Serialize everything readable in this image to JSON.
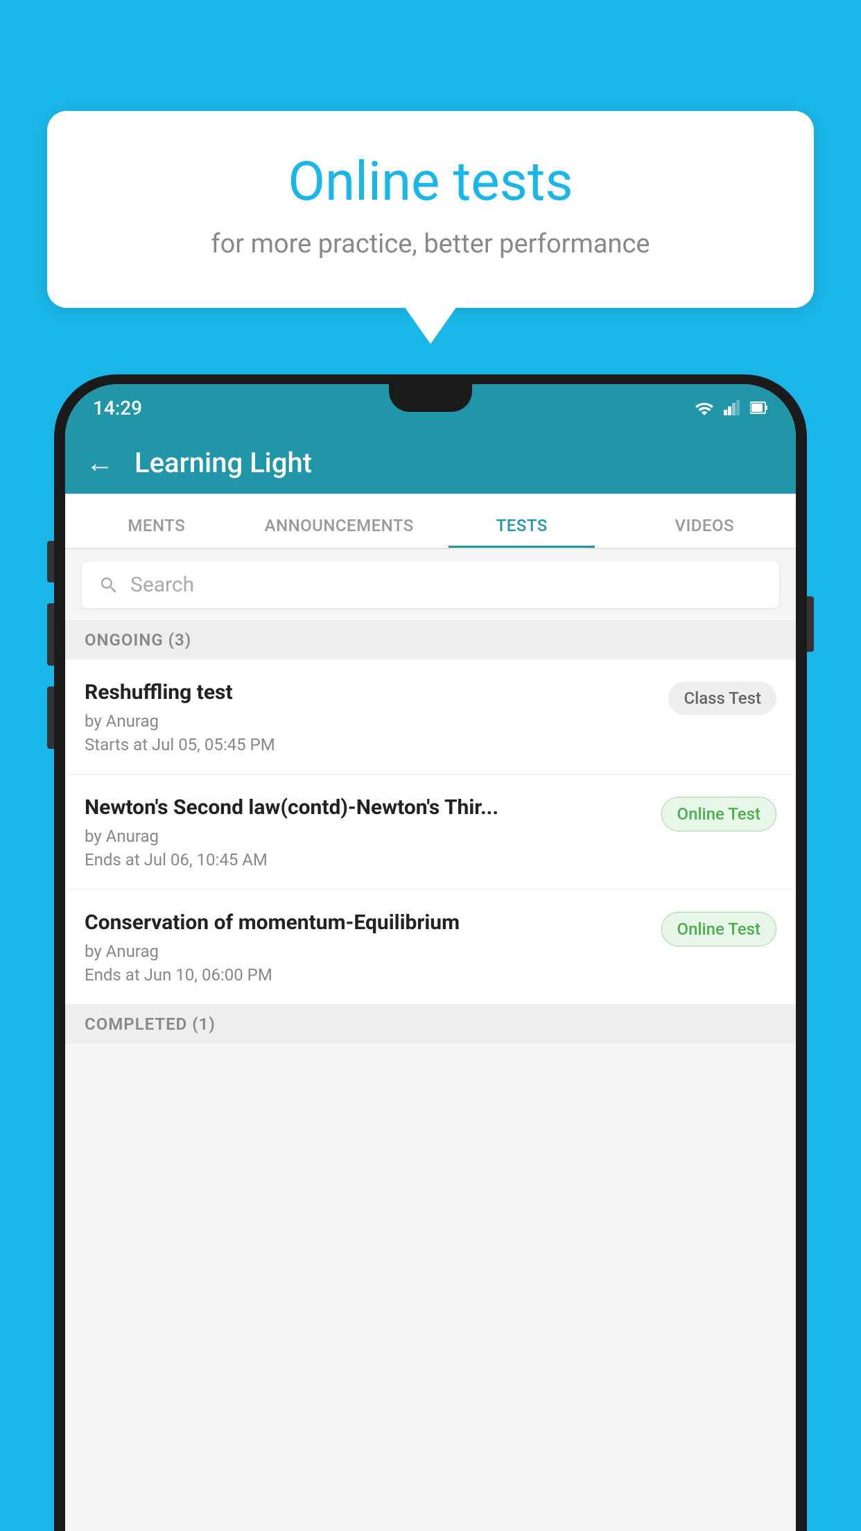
{
  "background_color": "#1ab6e8",
  "speech_bubble": {
    "title": "Online tests",
    "subtitle": "for more practice, better performance"
  },
  "phone": {
    "status_bar": {
      "time": "14:29"
    },
    "app_header": {
      "title": "Learning Light"
    },
    "tabs": [
      {
        "label": "MENTS",
        "active": false
      },
      {
        "label": "ANNOUNCEMENTS",
        "active": false
      },
      {
        "label": "TESTS",
        "active": true
      },
      {
        "label": "VIDEOS",
        "active": false
      }
    ],
    "search": {
      "placeholder": "Search"
    },
    "ongoing_section": {
      "label": "ONGOING (3)"
    },
    "tests": [
      {
        "name": "Reshuffling test",
        "author": "by Anurag",
        "date": "Starts at  Jul 05, 05:45 PM",
        "badge": "Class Test",
        "badge_type": "class"
      },
      {
        "name": "Newton's Second law(contd)-Newton's Thir...",
        "author": "by Anurag",
        "date": "Ends at  Jul 06, 10:45 AM",
        "badge": "Online Test",
        "badge_type": "online"
      },
      {
        "name": "Conservation of momentum-Equilibrium",
        "author": "by Anurag",
        "date": "Ends at  Jun 10, 06:00 PM",
        "badge": "Online Test",
        "badge_type": "online"
      }
    ],
    "completed_section": {
      "label": "COMPLETED (1)"
    }
  }
}
